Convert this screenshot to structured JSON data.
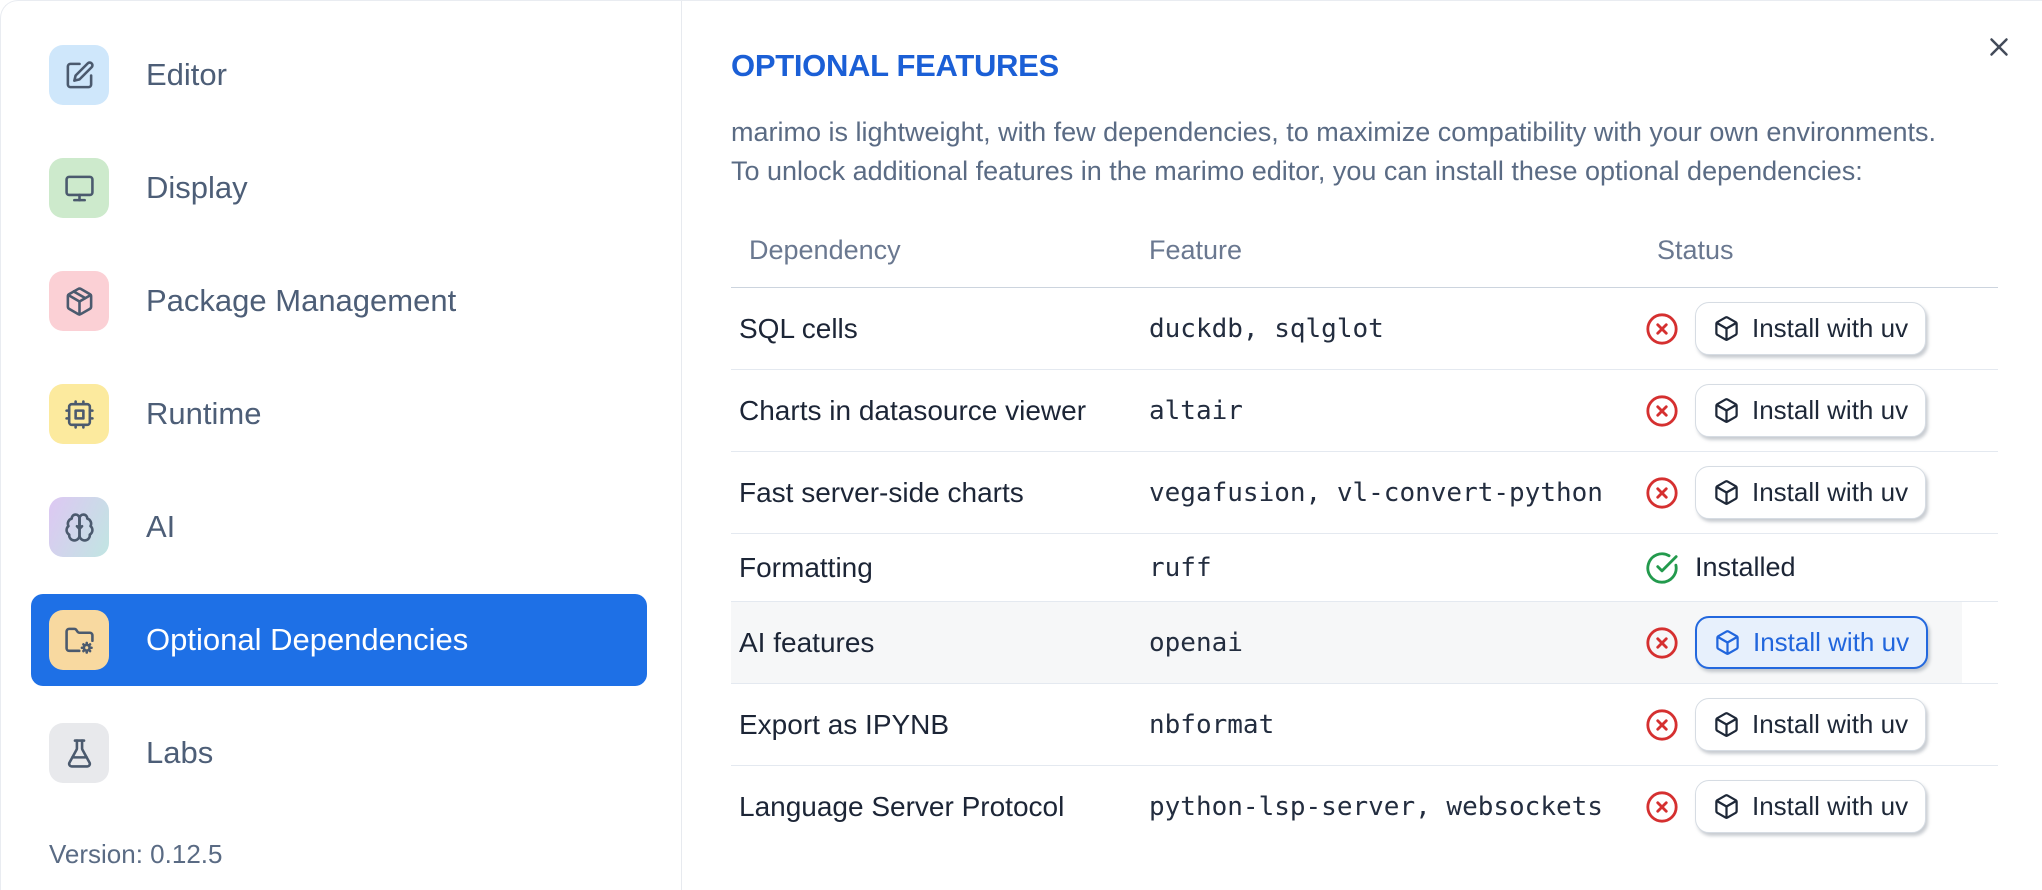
{
  "sidebar": {
    "items": [
      {
        "label": "Editor",
        "icon": "square-pen-icon",
        "iconBg": "#cfe7fb",
        "selected": false
      },
      {
        "label": "Display",
        "icon": "monitor-icon",
        "iconBg": "#cdeacc",
        "selected": false
      },
      {
        "label": "Package Management",
        "icon": "package-icon",
        "iconBg": "#fbd0d5",
        "selected": false
      },
      {
        "label": "Runtime",
        "icon": "cpu-icon",
        "iconBg": "#fcea9e",
        "selected": false
      },
      {
        "label": "AI",
        "icon": "brain-icon",
        "iconBg": "linear-gradient(115deg,#dcc9f2 5%,#c2e4e3 95%)",
        "selected": false
      },
      {
        "label": "Optional Dependencies",
        "icon": "folder-cog-icon",
        "iconBg": "#f8d9a0",
        "selected": true
      },
      {
        "label": "Labs",
        "icon": "flask-icon",
        "iconBg": "#e8e9ec",
        "selected": false
      }
    ],
    "version": "Version: 0.12.5"
  },
  "panel": {
    "title": "OPTIONAL FEATURES",
    "description_line1": "marimo is lightweight, with few dependencies, to maximize compatibility with your own environments.",
    "description_line2": "To unlock additional features in the marimo editor, you can install these optional dependencies:"
  },
  "table": {
    "headers": {
      "dependency": "Dependency",
      "feature": "Feature",
      "status": "Status"
    },
    "rows": [
      {
        "dependency": "SQL cells",
        "feature": "duckdb, sqlglot",
        "status": "missing",
        "action": "Install with uv",
        "highlighted": false
      },
      {
        "dependency": "Charts in datasource viewer",
        "feature": "altair",
        "status": "missing",
        "action": "Install with uv",
        "highlighted": false
      },
      {
        "dependency": "Fast server-side charts",
        "feature": "vegafusion, vl-convert-python",
        "status": "missing",
        "action": "Install with uv",
        "highlighted": false
      },
      {
        "dependency": "Formatting",
        "feature": "ruff",
        "status": "installed",
        "status_label": "Installed",
        "highlighted": false
      },
      {
        "dependency": "AI features",
        "feature": "openai",
        "status": "missing",
        "action": "Install with uv",
        "highlighted": true
      },
      {
        "dependency": "Export as IPYNB",
        "feature": "nbformat",
        "status": "missing",
        "action": "Install with uv",
        "highlighted": false
      },
      {
        "dependency": "Language Server Protocol",
        "feature": "python-lsp-server, websockets",
        "status": "missing",
        "action": "Install with uv",
        "highlighted": false
      }
    ]
  },
  "colors": {
    "selected_item_bg": "#1e70e6",
    "title_blue": "#1b5fd6",
    "highlight_button_blue": "#2368de",
    "status_missing_red": "#d53030",
    "status_installed_green": "#239a4d"
  }
}
